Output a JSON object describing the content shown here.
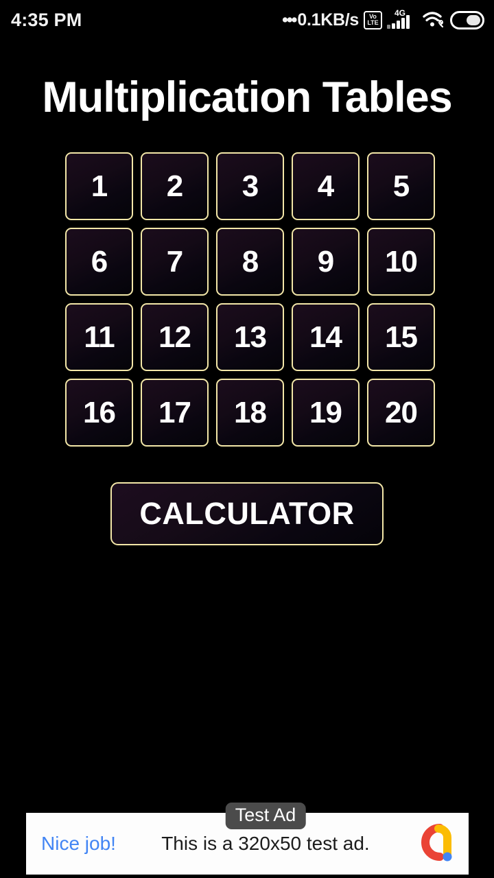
{
  "statusbar": {
    "time": "4:35 PM",
    "dots": "•••",
    "network_speed": "0.1KB/s",
    "volte_top": "Vo",
    "volte_bottom": "LTE",
    "network_type": "4G",
    "wifi_icon": "wifi-icon",
    "battery_icon": "battery-icon",
    "signal_icon": "signal-bars-icon"
  },
  "header": {
    "title": "Multiplication Tables"
  },
  "grid": {
    "tiles": [
      "1",
      "2",
      "3",
      "4",
      "5",
      "6",
      "7",
      "8",
      "9",
      "10",
      "11",
      "12",
      "13",
      "14",
      "15",
      "16",
      "17",
      "18",
      "19",
      "20"
    ]
  },
  "calculator": {
    "label": "CALCULATOR"
  },
  "ad": {
    "badge": "Test Ad",
    "headline": "Nice job!",
    "body": "This is a 320x50 test ad.",
    "logo_icon": "admob-logo-icon"
  },
  "colors": {
    "background": "#000000",
    "tile_border": "#f3e7a8",
    "tile_fill": "#140a16",
    "text": "#ffffff",
    "ad_headline": "#4285f4",
    "ad_background": "#fdfdfd",
    "ad_badge": "#4b4b4b"
  }
}
